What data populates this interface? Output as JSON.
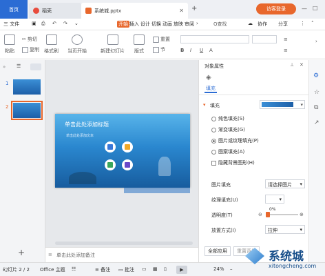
{
  "window": {
    "home_tab": "首页",
    "tabs": [
      {
        "label": "稻壳"
      },
      {
        "label": "系统城.pptx"
      }
    ],
    "visitor_button": "访客登录"
  },
  "menu": {
    "file": "三 文件",
    "items": [
      "开始",
      "插入",
      "设计",
      "切换",
      "动画",
      "放映",
      "审阅"
    ],
    "search": "Q查找",
    "collab": "协作",
    "share": "分享"
  },
  "ribbon": {
    "cut": "剪切",
    "paste": "粘贴",
    "copy": "复制",
    "format_painter": "格式刷",
    "play_from_current": "当页开始",
    "new_slide": "新建幻灯片",
    "layout": "版式",
    "section": "节",
    "reset": "重置"
  },
  "slides": {
    "numbers": [
      "1",
      "2"
    ],
    "selected": 2,
    "add": "+"
  },
  "slide": {
    "title_placeholder": "单击此处添加标题",
    "text_placeholder": "单击此处添加文本",
    "icon_colors": [
      "#3a78d8",
      "#f0a826",
      "#3aa65c",
      "#6a49c8"
    ]
  },
  "notes_placeholder": "单击此处添加备注",
  "panel": {
    "title": "对象属性",
    "tab_fill": "填充",
    "section_fill": "填充",
    "fill_options": [
      "纯色填充(S)",
      "渐变填充(G)",
      "图片或纹理填充(P)",
      "图案填充(A)"
    ],
    "selected_option": 2,
    "hide_bg": "隐藏背景图形(H)",
    "picture_fill_label": "图片填充",
    "picture_fill_value": "请选择图片",
    "texture_fill_label": "纹理填充(U)",
    "transparency_label": "透明度(T)",
    "transparency_value": "0%",
    "placement_label": "放置方式(I)",
    "placement_value": "拉伸",
    "apply_all": "全部应用",
    "reset_bg": "重置背景"
  },
  "status": {
    "slide_info": "幻灯片 2 / 2",
    "theme": "Office 主题",
    "notes": "备注",
    "comments": "批注",
    "zoom": "24%"
  },
  "watermark": {
    "brand": "系统城",
    "url": "xitongcheng.com"
  }
}
